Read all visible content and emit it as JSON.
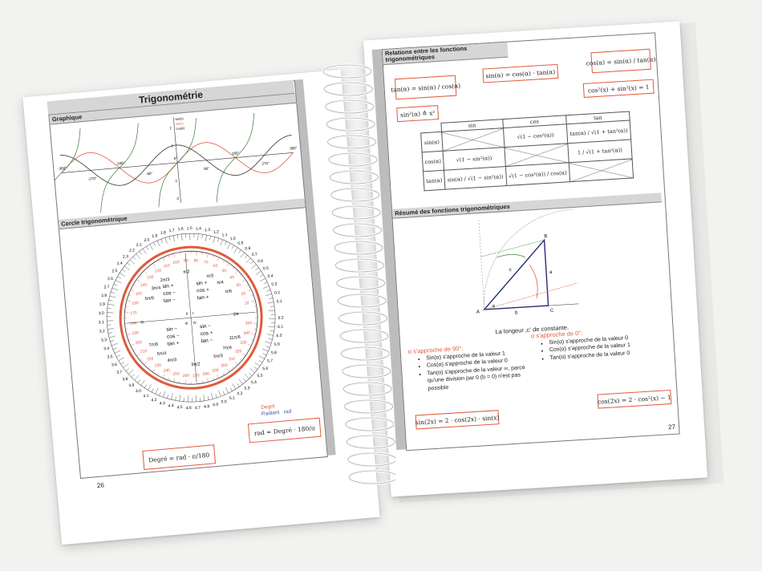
{
  "left_page": {
    "title": "Trigonométrie",
    "graph_section": "Graphique",
    "graph_labels": {
      "tan": "tan(x)",
      "sin": "sin(x)",
      "cos": "cos(x)",
      "y_ticks": [
        "2",
        "1",
        "-1",
        "-2"
      ],
      "x_ticks_deg": [
        "-360°",
        "-270°",
        "-180°",
        "-90°",
        "0°",
        "90°",
        "180°",
        "270°",
        "360°"
      ],
      "x_ticks_rad": [
        "-2π",
        "-3/2π",
        "-π",
        "-1/2π",
        "1/2π",
        "π",
        "3/2π",
        "2π"
      ]
    },
    "circle_section": "Cercle trigonométrique",
    "outer_radian_ticks": [
      "0.1",
      "0.2",
      "0.3",
      "0.4",
      "0.5",
      "0.6",
      "0.7",
      "0.8",
      "0.9",
      "1.0",
      "1.1",
      "1.2",
      "1.3",
      "1.4",
      "1.5",
      "1.6",
      "1.7",
      "1.8",
      "1.9",
      "2.0",
      "2.1",
      "2.2",
      "2.3",
      "2.4",
      "2.5",
      "2.6",
      "2.7",
      "2.8",
      "2.9",
      "3.0",
      "3.1",
      "3.2",
      "3.3",
      "3.4",
      "3.5",
      "3.6",
      "3.7",
      "3.8",
      "3.9",
      "4.0",
      "4.1",
      "4.2",
      "4.3",
      "4.4",
      "4.5",
      "4.6",
      "4.7",
      "4.8",
      "4.9",
      "5.0",
      "5.1",
      "5.2",
      "5.3",
      "5.4",
      "5.5",
      "5.6",
      "5.7",
      "5.8",
      "5.9",
      "6.0",
      "6.1",
      "6.2"
    ],
    "degree_ticks": [
      "10",
      "20",
      "30",
      "40",
      "50",
      "60",
      "70",
      "80",
      "90",
      "100",
      "110",
      "120",
      "130",
      "140",
      "150",
      "160",
      "170",
      "180",
      "190",
      "200",
      "210",
      "220",
      "230",
      "240",
      "250",
      "260",
      "270",
      "280",
      "290",
      "300",
      "310",
      "320",
      "330",
      "340",
      "350"
    ],
    "quadrant_signs": {
      "q1": [
        "sin  +",
        "cos  +",
        "tan  +"
      ],
      "q2": [
        "sin  +",
        "cos  −",
        "tan  −"
      ],
      "q3": [
        "sin  −",
        "cos  −",
        "tan  +"
      ],
      "q4": [
        "sin  −",
        "cos  +",
        "tan  −"
      ],
      "labels": [
        "II",
        "I",
        "III",
        "IV"
      ]
    },
    "special_angles": [
      "π/2",
      "π/3",
      "2π/3",
      "π/4",
      "3π/4",
      "π/6",
      "5π/6",
      "π",
      "2π",
      "7π/6",
      "11π/6",
      "5π/4",
      "7π/4",
      "4π/3",
      "5π/3",
      "3π/2"
    ],
    "legend": {
      "degree": "Degré",
      "radiant": "Radiant",
      "rad": "rad"
    },
    "formula_rad": "rad = Degré · 180/π",
    "formula_deg": "Degré = rad · π/180",
    "page_number": "26",
    "colors": {
      "accent": "#e05a3a",
      "legend_blue": "#3b55a5"
    }
  },
  "right_page": {
    "relations_section": "Relations entre les fonctions trigonométriques",
    "formulas": {
      "tan_def": "tan(α) = sin(α) / cos(α)",
      "sin_eq": "sin(α) = cos(α) · tan(α)",
      "cos_eq": "cos(α) = sin(α) / tan(α)",
      "sin2": "sin²(α) ≙ x²",
      "pythagore": "cos²(x) + sin²(x) = 1"
    },
    "table": {
      "headers": [
        "",
        "sin",
        "cos",
        "tan"
      ],
      "rows": [
        [
          "sin(α)",
          "",
          "√(1 − cos²(α))",
          "tan(α) / √(1 + tan²(α))"
        ],
        [
          "cos(α)",
          "√(1 − sin²(α))",
          "",
          "1 / √(1 + tan²(α))"
        ],
        [
          "tan(α)",
          "sin(α) / √(1 − sin²(α))",
          "√(1 − cos²(α)) / cos(α)",
          ""
        ]
      ]
    },
    "summary_section": "Résumé des fonctions trigonométriques",
    "triangle_labels": {
      "A": "A",
      "B": "B",
      "C": "C",
      "a": "a",
      "b": "b",
      "c": "c",
      "alpha": "α"
    },
    "caption": "La longeur ‚c‘ de constante.",
    "approach_90": {
      "header": "α s'approche de 90°:",
      "items": [
        "Sin(α) s'approche de la valeur 1",
        "Cos(α) s'approche de la valeur 0",
        "Tan(α) s'approche de la valeur ∞, parce qu'une division par 0 (b = 0) n'est pas possible"
      ]
    },
    "approach_0": {
      "header": "α s'approche de 0°:",
      "items": [
        "Sin(α) s'approche de la valeur 0",
        "Cos(α) s'approche de la valeur 1",
        "Tan(α) s'approche de la valeur 0"
      ]
    },
    "formula_sin2x": "sin(2x) = 2 · cos(2x) · sin(x)",
    "formula_cos2x": "cos(2x) = 2 · cos²(x) − 1",
    "page_number": "27",
    "colors": {
      "green": "#3a8a3a",
      "orange": "#e05a3a",
      "navy": "#2a2a7a"
    }
  }
}
